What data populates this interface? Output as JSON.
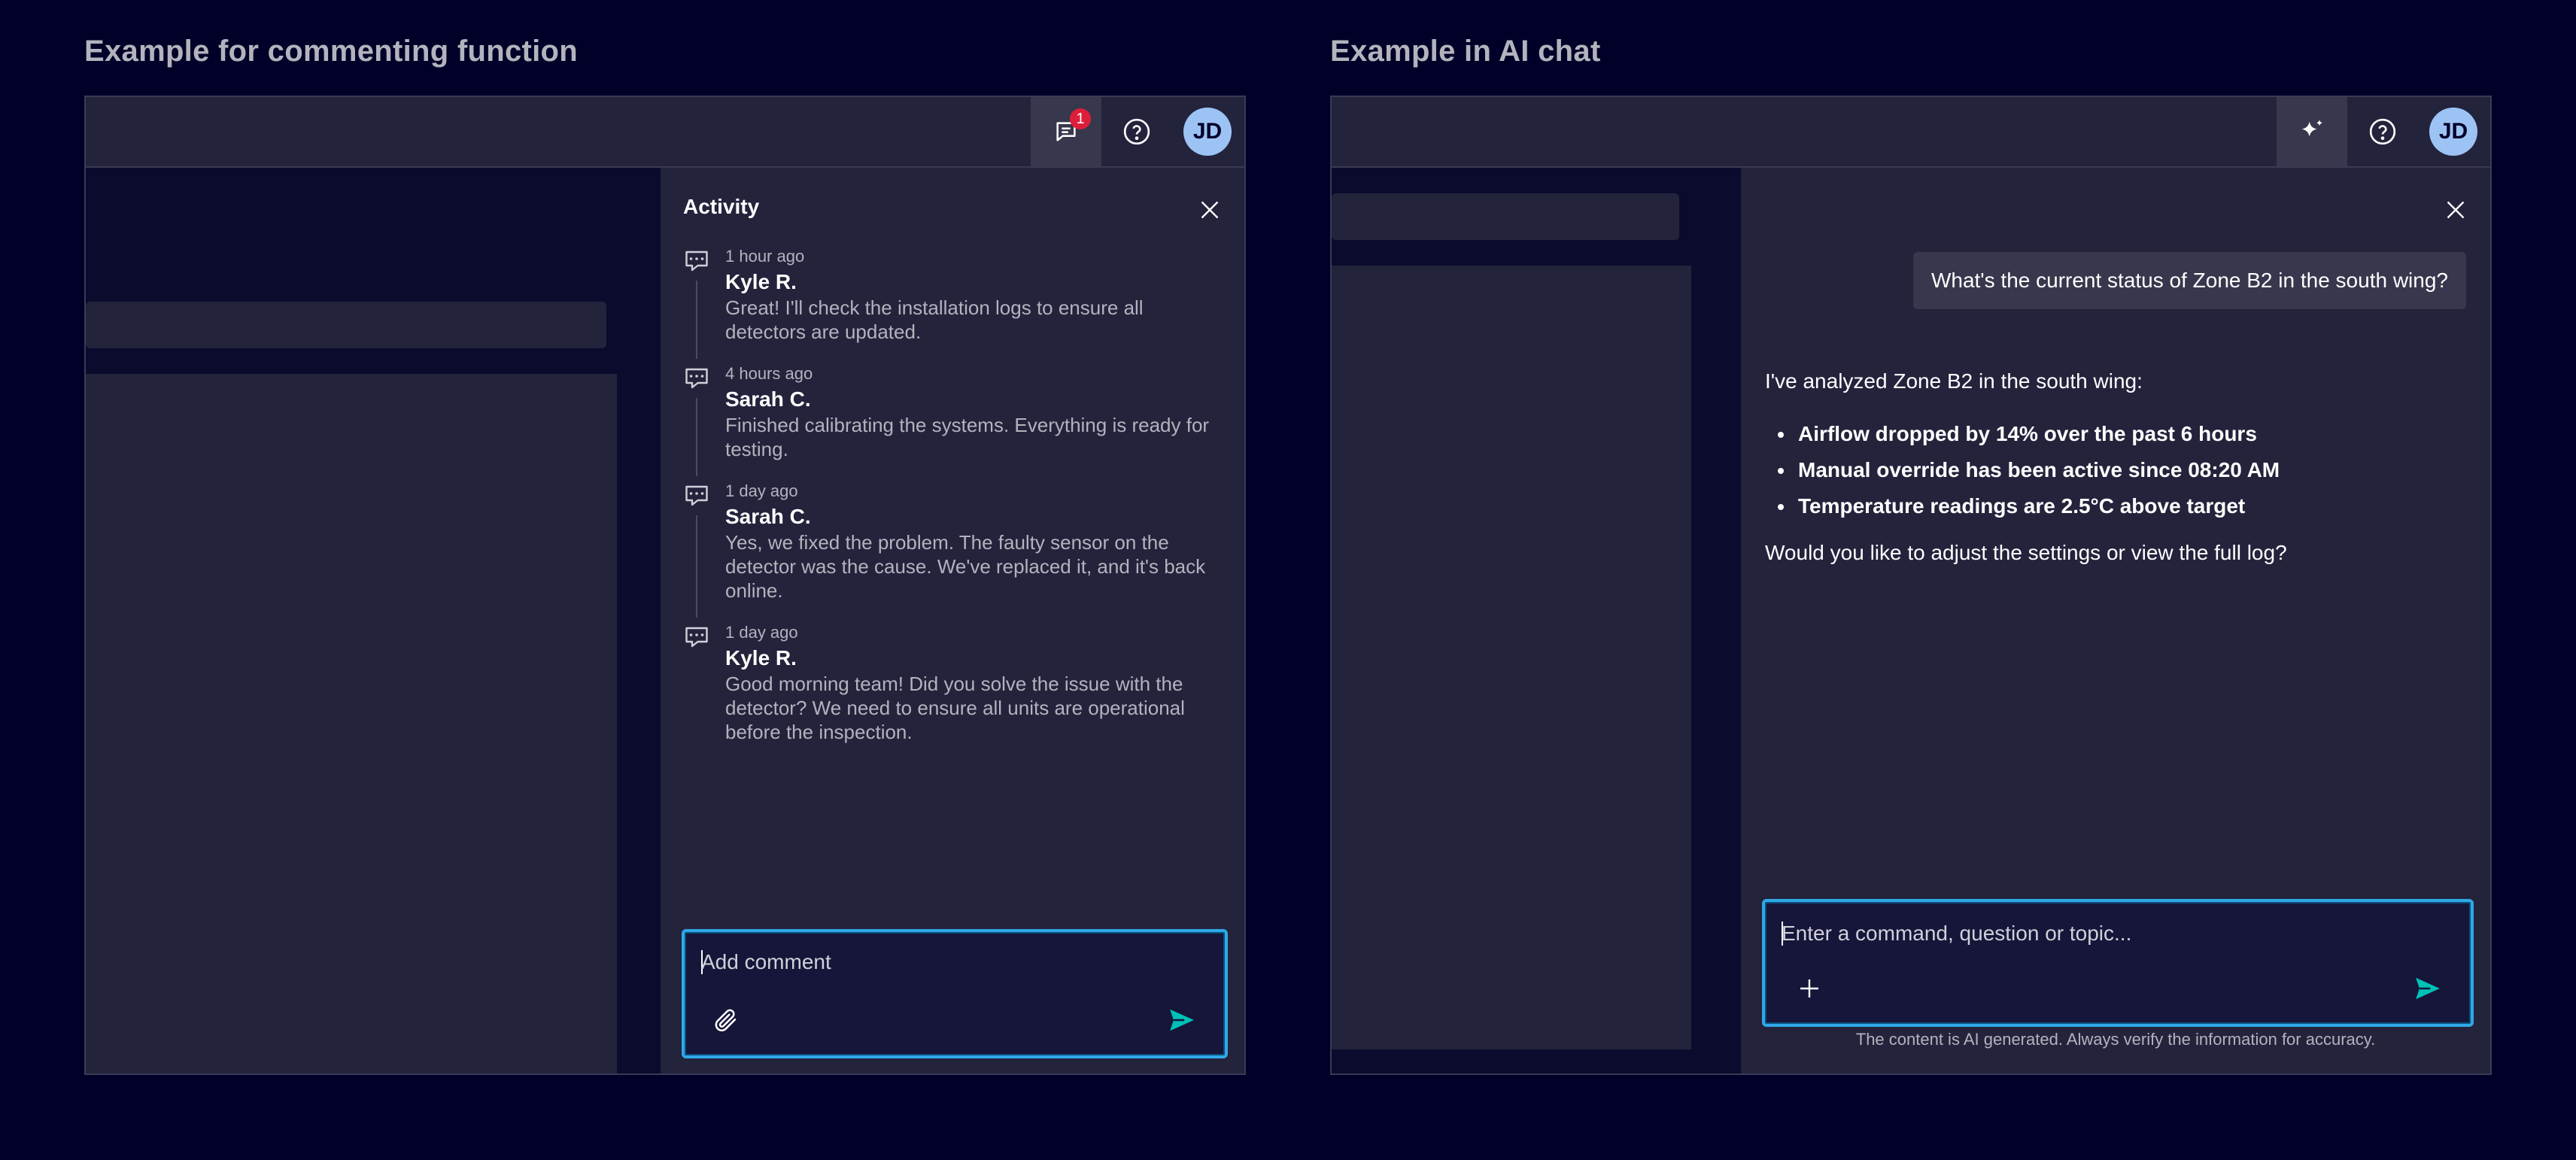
{
  "left_example": {
    "title": "Example for commenting function",
    "topbar": {
      "badge_count": "1",
      "avatar_initials": "JD"
    },
    "activity_panel": {
      "title": "Activity",
      "items": [
        {
          "time": "1 hour ago",
          "author": "Kyle R.",
          "text": "Great! I'll check the installation logs to ensure all detectors are updated."
        },
        {
          "time": "4 hours ago",
          "author": "Sarah C.",
          "text": "Finished calibrating the systems. Everything is ready for testing."
        },
        {
          "time": "1 day ago",
          "author": "Sarah C.",
          "text": "Yes, we fixed the problem. The faulty sensor on the detector was the cause. We've replaced it, and it's back online."
        },
        {
          "time": "1 day ago",
          "author": "Kyle R.",
          "text": "Good morning team! Did you solve the issue with the detector? We need to ensure all units are operational before the inspection."
        }
      ],
      "comment_placeholder": "Add comment"
    }
  },
  "right_example": {
    "title": "Example in AI chat",
    "topbar": {
      "avatar_initials": "JD"
    },
    "chat": {
      "user_message": "What's the current status of Zone B2 in the south wing?",
      "ai_intro": "I've analyzed Zone B2 in the south wing:",
      "ai_points": [
        "Airflow dropped by 14% over the past 6 hours",
        "Manual override has been active since 08:20 AM",
        "Temperature readings are 2.5°C above target"
      ],
      "ai_question": "Would you like to adjust the settings or view the full log?",
      "input_placeholder": "Enter a command, question or topic...",
      "disclaimer": "The content is AI generated. Always verify the information for accuracy."
    }
  },
  "colors": {
    "background": "#000028",
    "panel": "#23233c",
    "accent_teal": "#00c1b6",
    "focus_blue": "#30a8e8",
    "avatar": "#9dc3f5",
    "badge_red": "#dd1e3b"
  }
}
